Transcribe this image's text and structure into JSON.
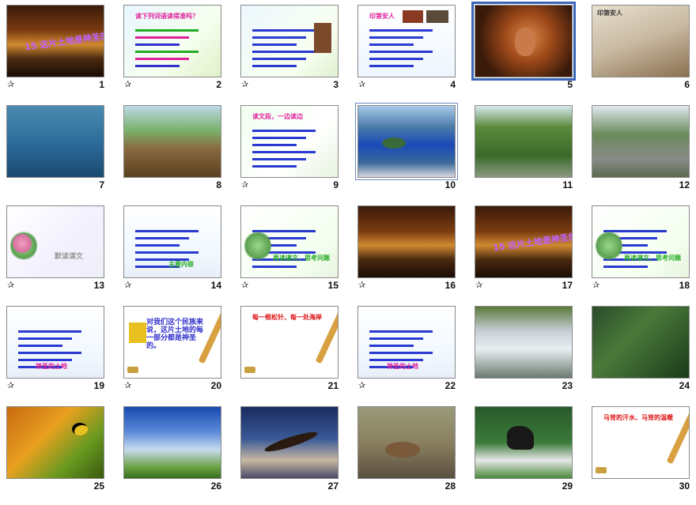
{
  "slides": [
    {
      "num": "1",
      "starred": true,
      "bg": "sunset",
      "title": "15 这片土地是神圣的",
      "title_color": "#c060ff"
    },
    {
      "num": "2",
      "starred": true,
      "bg": "quiz",
      "title": "读下列词语读得准吗？",
      "title_color": "#e0209a"
    },
    {
      "num": "3",
      "starred": true,
      "bg": "letter",
      "title": "",
      "title_color": "#e0209a"
    },
    {
      "num": "4",
      "starred": true,
      "bg": "textimg",
      "title": "印第安人",
      "title_color": "#e0209a"
    },
    {
      "num": "5",
      "starred": false,
      "bg": "chief",
      "title": "",
      "title_color": "#ffffff"
    },
    {
      "num": "6",
      "starred": false,
      "bg": "warrior",
      "title": "印第安人",
      "title_color": "#ffffff"
    },
    {
      "num": "7",
      "starred": false,
      "bg": "canoe",
      "title": "",
      "title_color": "#ffffff"
    },
    {
      "num": "8",
      "starred": false,
      "bg": "hut",
      "title": "",
      "title_color": "#ffffff"
    },
    {
      "num": "9",
      "starred": true,
      "bg": "text",
      "title": "读文段，一边读边",
      "title_color": "#e0209a"
    },
    {
      "num": "10",
      "starred": false,
      "bg": "lake",
      "title": "",
      "title_color": "#ffffff"
    },
    {
      "num": "11",
      "starred": false,
      "bg": "park",
      "title": "",
      "title_color": "#ffffff"
    },
    {
      "num": "12",
      "starred": false,
      "bg": "road",
      "title": "",
      "title_color": "#ffffff"
    },
    {
      "num": "13",
      "starred": true,
      "bg": "floral",
      "title": "默读课文",
      "title_color": "#9a9a9a"
    },
    {
      "num": "14",
      "starred": true,
      "bg": "bullets",
      "title": "主要内容",
      "title_color": "#22aa22"
    },
    {
      "num": "15",
      "starred": true,
      "bg": "reading",
      "title": "再读课文，思考问题",
      "title_color": "#22aa22"
    },
    {
      "num": "16",
      "starred": true,
      "bg": "sunset",
      "title": "",
      "title_color": "#ff7aa0"
    },
    {
      "num": "17",
      "starred": true,
      "bg": "sunset",
      "title": "15 这片土地是神圣的",
      "title_color": "#c060ff"
    },
    {
      "num": "18",
      "starred": true,
      "bg": "reading",
      "title": "再读课文，思考问题",
      "title_color": "#22aa22"
    },
    {
      "num": "19",
      "starred": true,
      "bg": "bullets",
      "title": "神圣的土地",
      "title_color": "#e0209a"
    },
    {
      "num": "20",
      "starred": true,
      "bg": "scroll",
      "title": "对我们这个民族来说，这片土地的每一部分都是神圣的。",
      "title_color": "#3030cc"
    },
    {
      "num": "21",
      "starred": false,
      "bg": "scrollred",
      "title": "每一根松针、每一处海岸",
      "title_color": "#dd1111"
    },
    {
      "num": "22",
      "starred": true,
      "bg": "bullets",
      "title": "神圣的土地",
      "title_color": "#e0209a"
    },
    {
      "num": "23",
      "starred": false,
      "bg": "river",
      "title": "",
      "title_color": "#ffffff"
    },
    {
      "num": "24",
      "starred": false,
      "bg": "pine",
      "title": "",
      "title_color": "#22ff22"
    },
    {
      "num": "25",
      "starred": false,
      "bg": "ladybug",
      "title": "",
      "title_color": "#ffffff"
    },
    {
      "num": "26",
      "starred": false,
      "bg": "sky",
      "title": "",
      "title_color": "#ffffff"
    },
    {
      "num": "27",
      "starred": false,
      "bg": "eagle",
      "title": "",
      "title_color": "#ffe0a0"
    },
    {
      "num": "28",
      "starred": false,
      "bg": "deer",
      "title": "",
      "title_color": "#ffffff"
    },
    {
      "num": "29",
      "starred": false,
      "bg": "horse",
      "title": "",
      "title_color": "#ffffff"
    },
    {
      "num": "30",
      "starred": false,
      "bg": "scrollred",
      "title": "马背的汗水、马背的温暖",
      "title_color": "#dd1111"
    }
  ],
  "selected_slide": "5",
  "framed_slide": "10",
  "star_glyph": "✰",
  "selection_color": "#3a66b8"
}
